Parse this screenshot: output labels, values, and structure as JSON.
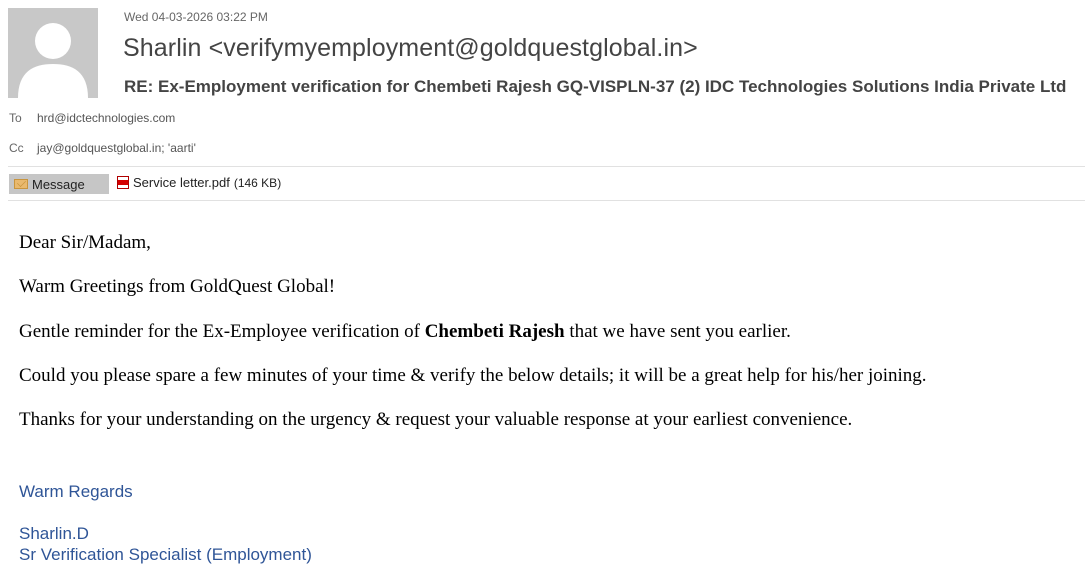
{
  "header": {
    "date": "Wed 04-03-2026 03:22 PM",
    "sender": "Sharlin <verifymyemployment@goldquestglobal.in>",
    "subject": "RE: Ex-Employment verification for Chembeti Rajesh GQ-VISPLN-37 (2) IDC Technologies Solutions India Private Ltd",
    "to_label": "To",
    "to_value": "hrd@idctechnologies.com",
    "cc_label": "Cc",
    "cc_value": "jay@goldquestglobal.in; 'aarti'"
  },
  "tabs": {
    "message_label": "Message",
    "message_icon": "envelope-icon"
  },
  "attachment": {
    "name": "Service letter.pdf",
    "size": "(146 KB)",
    "icon": "pdf-icon"
  },
  "body": {
    "greeting": "Dear Sir/Madam,",
    "line1": "Warm Greetings from GoldQuest Global!",
    "line2_before": "Gentle reminder for the Ex-Employee verification of ",
    "line2_bold": "Chembeti Rajesh",
    "line2_after": " that we have sent you earlier.",
    "line3": "Could you please spare a few minutes of your time & verify the below details; it will be a great help for his/her joining.",
    "line4": "Thanks for your understanding on the urgency & request your valuable response at your earliest convenience."
  },
  "signature": {
    "regards": "Warm Regards",
    "name": "Sharlin.D",
    "title": "Sr Verification Specialist (Employment)",
    "color": "#2f5597"
  }
}
